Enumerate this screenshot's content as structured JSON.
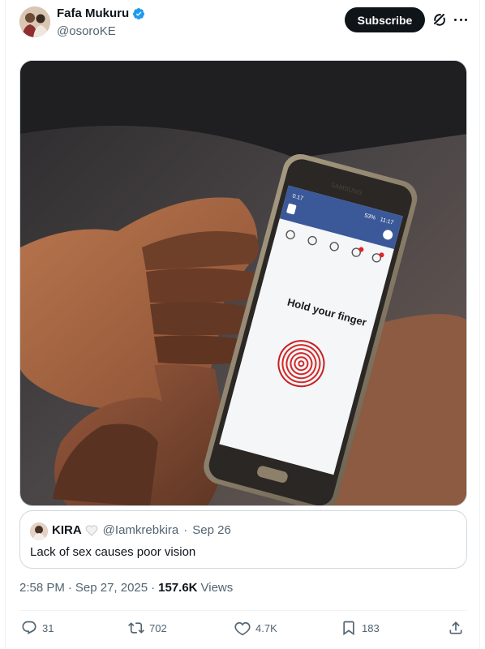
{
  "author": {
    "display_name": "Fafa Mukuru",
    "handle": "@osoroKE"
  },
  "header": {
    "subscribe_label": "Subscribe"
  },
  "media": {
    "screen_time": "0.17",
    "screen_battery": "53%",
    "screen_clock": "11:17",
    "screen_prompt": "Hold your finger",
    "phone_brand": "SAMSUNG"
  },
  "quoted_post": {
    "name": "KIRA",
    "handle": "@Iamkrebkira",
    "date": "Sep 26",
    "separator": "·",
    "text": "Lack of sex causes poor vision"
  },
  "meta": {
    "time": "2:58 PM",
    "separator": "·",
    "date": "Sep 27, 2025",
    "views_count": "157.6K",
    "views_label": "Views"
  },
  "actions": {
    "replies": "31",
    "reposts": "702",
    "likes": "4.7K",
    "bookmarks": "183"
  },
  "icons": {
    "verified": "verified-badge-icon",
    "grok": "grok-icon",
    "more": "more-icon",
    "reply": "reply-icon",
    "repost": "repost-icon",
    "like": "heart-icon",
    "bookmark": "bookmark-icon",
    "share": "share-icon"
  },
  "colors": {
    "verified_blue": "#1d9bf0",
    "text_primary": "#0f1419",
    "text_secondary": "#536471",
    "border": "#cfd9de"
  }
}
